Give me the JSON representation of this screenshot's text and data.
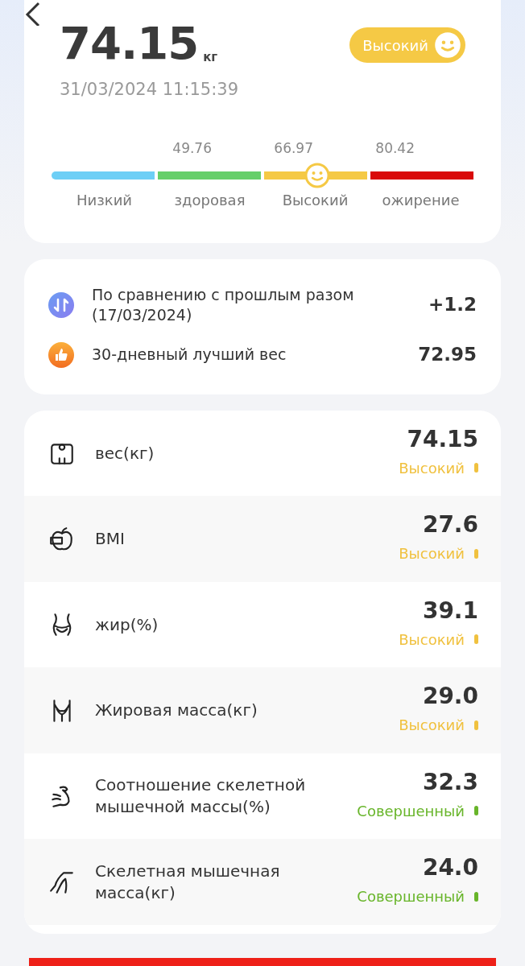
{
  "header": {
    "weight": "74.15",
    "unit": "кг",
    "datetime": "31/03/2024 11:15:39",
    "badge": {
      "label": "Высокий",
      "color": "#f5c945"
    }
  },
  "scale": {
    "thresholds": [
      "49.76",
      "66.97",
      "80.42"
    ],
    "level": 0.63,
    "segments": [
      {
        "label": "Низкий",
        "color": "#6dcff6"
      },
      {
        "label": "здоровая",
        "color": "#66cf6a"
      },
      {
        "label": "Высокий",
        "color": "#f5c945"
      },
      {
        "label": "ожирение",
        "color": "#d90a0a"
      }
    ]
  },
  "comparison": [
    {
      "kind": "change",
      "label": "По сравнению с прошлым разом (17/03/2024)",
      "value": "+1.2"
    },
    {
      "kind": "best",
      "label": "30-дневный лучший вес",
      "value": "72.95"
    }
  ],
  "metrics": [
    {
      "kind": "scale",
      "label": "вес(кг)",
      "value": "74.15",
      "status": "Высокий",
      "color": "#f0c13f"
    },
    {
      "kind": "apple",
      "label": "BMI",
      "value": "27.6",
      "status": "Высокий",
      "color": "#f0c13f"
    },
    {
      "kind": "waist",
      "label": "жир(%)",
      "value": "39.1",
      "status": "Высокий",
      "color": "#f0c13f"
    },
    {
      "kind": "torso",
      "label": "Жировая масса(кг)",
      "value": "29.0",
      "status": "Высокий",
      "color": "#f0c13f"
    },
    {
      "kind": "arm",
      "label": "Соотношение скелетной мышечной массы(%)",
      "value": "32.3",
      "status": "Совершенный",
      "color": "#68b52a"
    },
    {
      "kind": "leg",
      "label": "Скелетная мышечная масса(кг)",
      "value": "24.0",
      "status": "Совершенный",
      "color": "#68b52a"
    }
  ]
}
